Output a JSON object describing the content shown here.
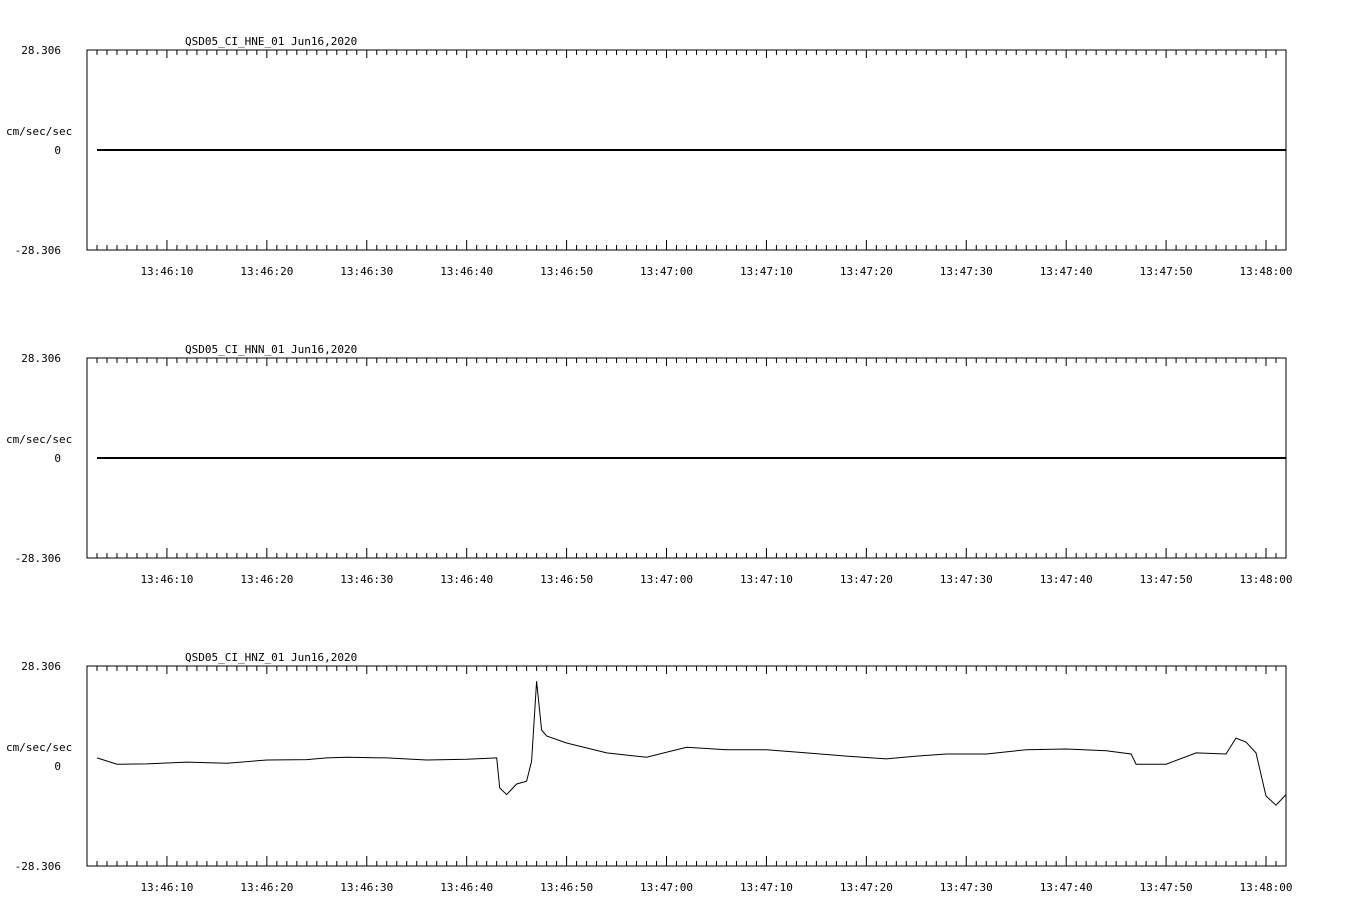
{
  "chart_data": [
    {
      "type": "line",
      "title": "QSD05_CI_HNE_01  Jun16,2020",
      "ylabel": "cm/sec/sec",
      "ytick_labels": [
        "28.306",
        "0",
        "-28.306"
      ],
      "ylim": [
        -28.306,
        28.306
      ],
      "xlim": [
        "13:46:02",
        "13:48:02"
      ],
      "xtick_labels": [
        "13:46:10",
        "13:46:20",
        "13:46:30",
        "13:46:40",
        "13:46:50",
        "13:47:00",
        "13:47:10",
        "13:47:20",
        "13:47:30",
        "13:47:40",
        "13:47:50",
        "13:48:00"
      ],
      "series": [
        {
          "x": [
            "13:46:03",
            "13:48:02"
          ],
          "y": [
            0,
            0
          ]
        }
      ]
    },
    {
      "type": "line",
      "title": "QSD05_CI_HNN_01  Jun16,2020",
      "ylabel": "cm/sec/sec",
      "ytick_labels": [
        "28.306",
        "0",
        "-28.306"
      ],
      "ylim": [
        -28.306,
        28.306
      ],
      "xlim": [
        "13:46:02",
        "13:48:02"
      ],
      "xtick_labels": [
        "13:46:10",
        "13:46:20",
        "13:46:30",
        "13:46:40",
        "13:46:50",
        "13:47:00",
        "13:47:10",
        "13:47:20",
        "13:47:30",
        "13:47:40",
        "13:47:50",
        "13:48:00"
      ],
      "series": [
        {
          "x": [
            "13:46:03",
            "13:48:02"
          ],
          "y": [
            0,
            0
          ]
        }
      ]
    },
    {
      "type": "line",
      "title": "QSD05_CI_HNZ_01  Jun16,2020",
      "ylabel": "cm/sec/sec",
      "ytick_labels": [
        "28.306",
        "0",
        "-28.306"
      ],
      "ylim": [
        -28.306,
        28.306
      ],
      "xlim": [
        "13:46:02",
        "13:48:02"
      ],
      "xtick_labels": [
        "13:46:10",
        "13:46:20",
        "13:46:30",
        "13:46:40",
        "13:46:50",
        "13:47:00",
        "13:47:10",
        "13:47:20",
        "13:47:30",
        "13:47:40",
        "13:47:50",
        "13:48:00"
      ],
      "series": [
        {
          "x": [
            "13:46:03",
            "13:46:05",
            "13:46:08",
            "13:46:12",
            "13:46:16",
            "13:46:20",
            "13:46:24",
            "13:46:26",
            "13:46:28",
            "13:46:32",
            "13:46:36",
            "13:46:40",
            "13:46:43",
            "13:46:43.3",
            "13:46:44",
            "13:46:45",
            "13:46:46",
            "13:46:46.5",
            "13:46:47",
            "13:46:47.5",
            "13:46:48",
            "13:46:50",
            "13:46:54",
            "13:46:58",
            "13:47:02",
            "13:47:06",
            "13:47:10",
            "13:47:14",
            "13:47:18",
            "13:47:22",
            "13:47:25",
            "13:47:28",
            "13:47:32",
            "13:47:36",
            "13:47:40",
            "13:47:44",
            "13:47:46.5",
            "13:47:47",
            "13:47:50",
            "13:47:53",
            "13:47:56",
            "13:47:57",
            "13:47:58",
            "13:47:59",
            "13:48:00",
            "13:48:01",
            "13:48:02"
          ],
          "y": [
            2.3,
            0.5,
            0.6,
            1.1,
            0.8,
            1.7,
            1.8,
            2.3,
            2.5,
            2.3,
            1.7,
            1.9,
            2.3,
            -6.2,
            -8.1,
            -5.1,
            -4.3,
            1.4,
            24.0,
            10.2,
            8.5,
            6.5,
            3.7,
            2.5,
            5.3,
            4.6,
            4.6,
            3.7,
            2.8,
            2.0,
            2.8,
            3.4,
            3.4,
            4.6,
            4.8,
            4.3,
            3.4,
            0.5,
            0.5,
            3.7,
            3.4,
            7.9,
            6.8,
            3.7,
            -8.5,
            -11.1,
            -8.1
          ]
        }
      ]
    }
  ]
}
